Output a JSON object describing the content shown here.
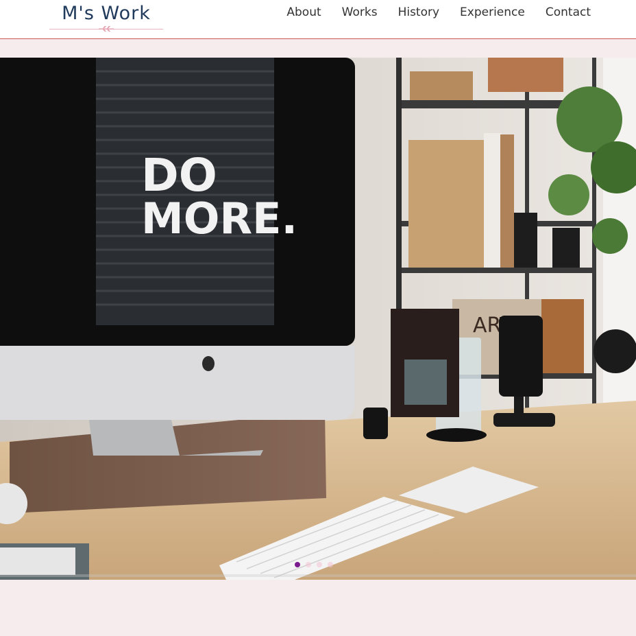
{
  "header": {
    "logo_text": "M's Work",
    "nav": [
      {
        "label": "About"
      },
      {
        "label": "Works"
      },
      {
        "label": "History"
      },
      {
        "label": "Experience"
      },
      {
        "label": "Contact"
      }
    ]
  },
  "hero": {
    "screen_text_line1": "DO",
    "screen_text_line2": "MORE.",
    "slides_total": 4,
    "slide_active": 1
  },
  "colors": {
    "background": "#f7eced",
    "header_border": "#c9574d",
    "logo": "#213b5c",
    "dot_active": "#7a1a8e",
    "dot_inactive": "#f4c6d5"
  }
}
